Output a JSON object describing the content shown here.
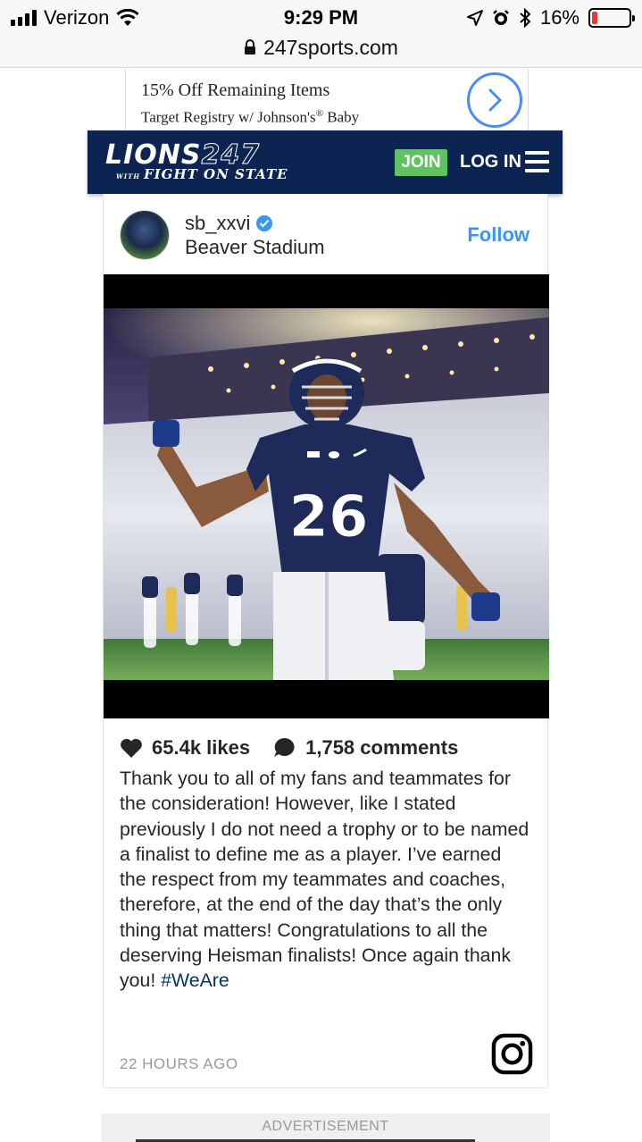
{
  "status_bar": {
    "carrier": "Verizon",
    "time": "9:29 PM",
    "battery": "16%",
    "battery_level": 0.16,
    "icons": [
      "signal-icon",
      "wifi-icon",
      "location-arrow-icon",
      "alarm-icon",
      "bluetooth-icon",
      "battery-icon"
    ]
  },
  "browser": {
    "url": "247sports.com",
    "url_icon": "lock-icon"
  },
  "ad_banner": {
    "line1": "15% Off Remaining Items",
    "line2_prefix": "Target Registry w/ Johnson's",
    "line2_reg": "®",
    "line2_suffix": " Baby",
    "arrow_icon": "chevron-right-icon",
    "accent": "#4a8cf7"
  },
  "site_header": {
    "logo_part1": "LIONS",
    "logo_part2": "247",
    "logo_with": "WITH",
    "logo_sub": "FIGHT ON STATE",
    "join_label": "JOIN",
    "login_label": "LOG IN",
    "menu_icon": "hamburger-menu-icon",
    "background": "#0c2452",
    "join_color": "#5fc35f"
  },
  "post": {
    "username": "sb_xxvi",
    "verified": true,
    "location": "Beaver Stadium",
    "follow_label": "Follow",
    "likes": "65.4k likes",
    "comments": "1,758 comments",
    "caption": "Thank you to all of my fans and teammates for the consideration! However, like I stated previously I do not need a trophy or to be named a finalist to define me as a player. I’ve earned the respect from my teammates and coaches, therefore, at the end of the day that’s the only thing that matters! Congratulations to all the deserving Heisman finalists! Once again thank you!",
    "hashtag": "#WeAre",
    "timestamp": "22 HOURS AGO",
    "jersey_number": "26",
    "accent": "#3897f0"
  },
  "footer": {
    "advertisement_label": "ADVERTISEMENT"
  }
}
